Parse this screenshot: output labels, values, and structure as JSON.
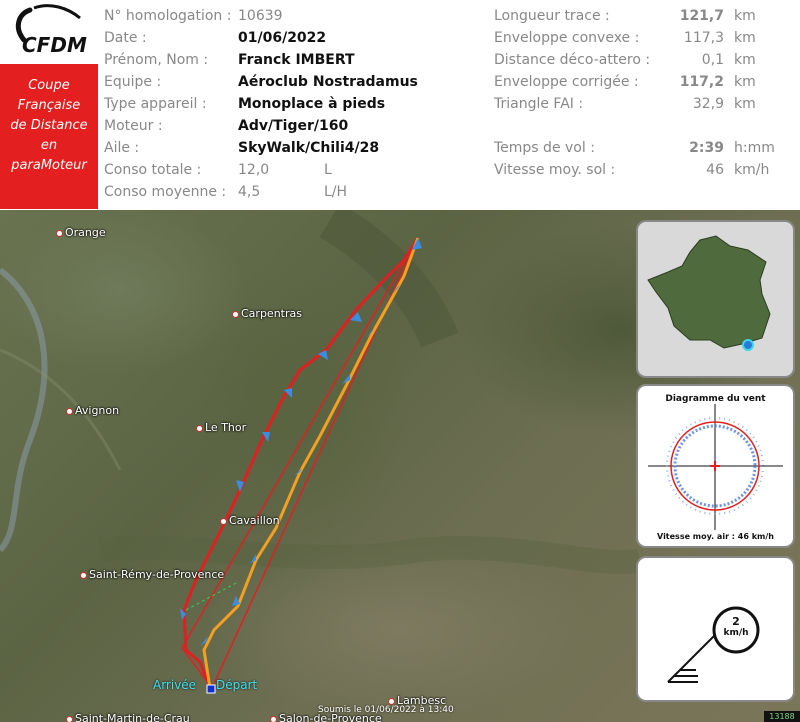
{
  "logo": {
    "text": "CFDM"
  },
  "coupe": {
    "lines": [
      "Coupe",
      "Française",
      "de Distance",
      "en",
      "paraMoteur"
    ]
  },
  "left_labels": [
    "N° homologation :",
    "Date :",
    "Prénom, Nom :",
    "Equipe :",
    "Type appareil :",
    "Moteur :",
    "Aile :",
    "Conso totale :",
    "Conso moyenne :"
  ],
  "left_values": {
    "homologation": "10639",
    "date": "01/06/2022",
    "name": "Franck IMBERT",
    "team": "Aéroclub Nostradamus",
    "aircraft": "Monoplace à pieds",
    "engine": "Adv/Tiger/160",
    "wing": "SkyWalk/Chili4/28",
    "conso_total": "12,0",
    "conso_total_unit": "L",
    "conso_avg": "4,5",
    "conso_avg_unit": "L/H"
  },
  "right_stats": [
    {
      "label": "Longueur trace :",
      "value": "121,7",
      "unit": "km",
      "bold": true
    },
    {
      "label": "Enveloppe convexe :",
      "value": "117,3",
      "unit": "km",
      "bold": false
    },
    {
      "label": "Distance déco-attero :",
      "value": "0,1",
      "unit": "km",
      "bold": false
    },
    {
      "label": "Enveloppe corrigée :",
      "value": "117,2",
      "unit": "km",
      "bold": true
    },
    {
      "label": "Triangle FAI :",
      "value": "32,9",
      "unit": "km",
      "bold": false
    },
    {
      "label": "Temps de vol :",
      "value": "2:39",
      "unit": "h:mm",
      "bold": true
    },
    {
      "label": "Vitesse moy. sol :",
      "value": "46",
      "unit": "km/h",
      "bold": false
    }
  ],
  "towns": {
    "orange": "Orange",
    "carpentras": "Carpentras",
    "avignon": "Avignon",
    "lethor": "Le Thor",
    "cavaillon": "Cavaillon",
    "stremy": "Saint-Rémy-de-Provence",
    "stmartin": "Saint-Martin-de-Crau",
    "salon": "Salon-de-Provence",
    "lambesc": "Lambesc"
  },
  "markers": {
    "arrivee": "Arrivée",
    "depart": "Départ"
  },
  "wind_panel": {
    "title": "Diagramme du vent",
    "caption": "Vitesse moy. air : 46 km/h"
  },
  "wind_indicator": {
    "speed": "2",
    "unit": "km/h"
  },
  "footer": {
    "submitted": "Soumis le 01/06/2022 à 13:40",
    "badge": "13188"
  },
  "colors": {
    "accent_red": "#e41f1f",
    "track_orange": "#f5a020",
    "track_red": "#e02020",
    "arrow_blue": "#3a8de0"
  }
}
